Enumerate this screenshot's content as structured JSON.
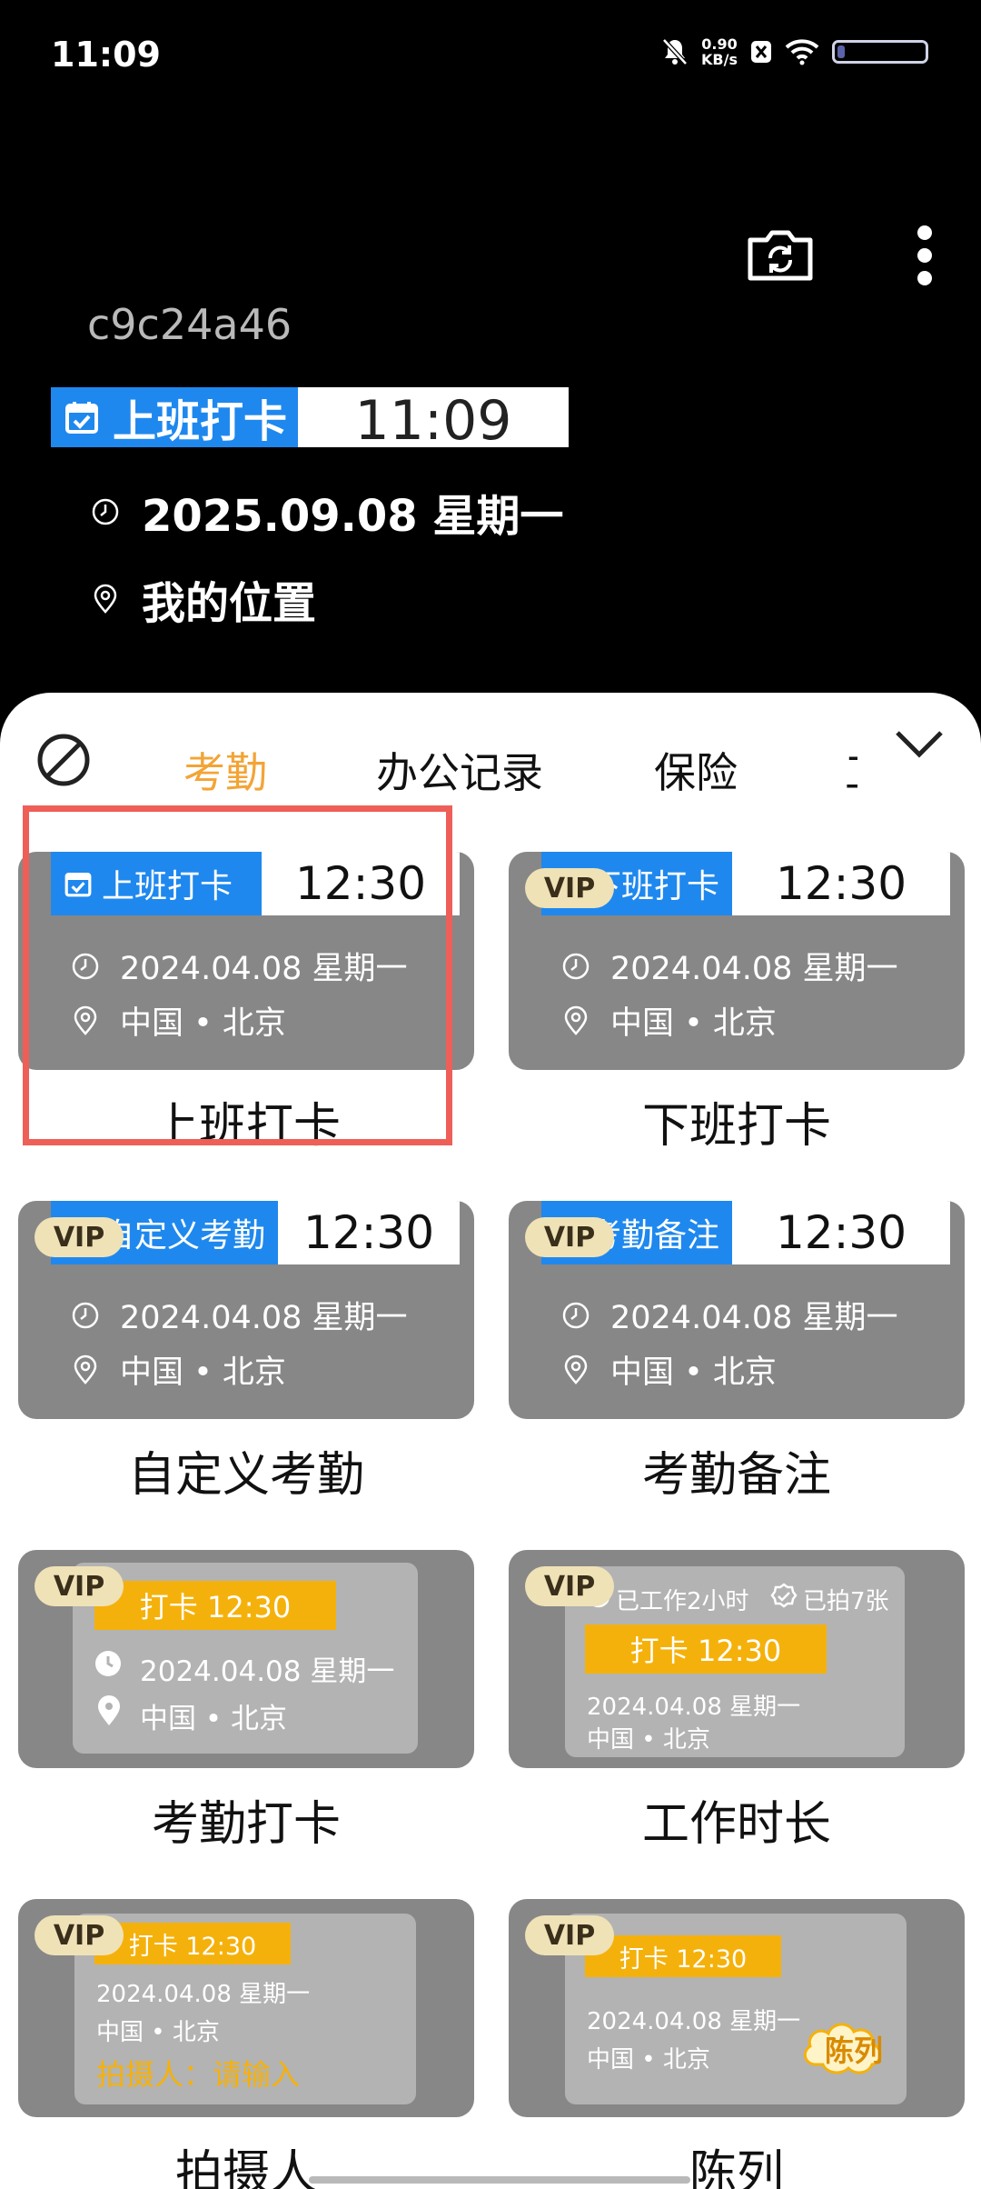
{
  "status": {
    "time": "11:09",
    "speed_value": "0.90",
    "speed_unit": "KB/s"
  },
  "camera": {
    "device_id": "c9c24a46",
    "watermark": {
      "tag": "上班打卡",
      "time": "11:09",
      "date": "2025.09.08 星期一",
      "location": "我的位置"
    }
  },
  "tabs": [
    "考勤",
    "办公记录",
    "保险",
    "工"
  ],
  "templates": {
    "card1": {
      "tag": "上班打卡",
      "time": "12:30",
      "date": "2024.04.08  星期一",
      "location": "中国 • 北京",
      "caption": "上班打卡"
    },
    "card2": {
      "vip": "VIP",
      "tag": "下班打卡",
      "time": "12:30",
      "date": "2024.04.08  星期一",
      "location": "中国 • 北京",
      "caption": "下班打卡"
    },
    "card3": {
      "vip": "VIP",
      "tag": "自定义考勤",
      "time": "12:30",
      "date": "2024.04.08  星期一",
      "location": "中国 • 北京",
      "caption": "自定义考勤"
    },
    "card4": {
      "vip": "VIP",
      "tag": "考勤备注",
      "time": "12:30",
      "date": "2024.04.08  星期一",
      "location": "中国 • 北京",
      "caption": "考勤备注"
    },
    "card5": {
      "vip": "VIP",
      "bar": "打卡  12:30",
      "date": "2024.04.08  星期一",
      "location": "中国 • 北京",
      "caption": "考勤打卡"
    },
    "card6": {
      "vip": "VIP",
      "worked": "已工作2小时",
      "photos": "已拍7张",
      "bar": "打卡  12:30",
      "date": "2024.04.08 星期一",
      "location": "中国 • 北京",
      "caption": "工作时长"
    },
    "card7": {
      "vip": "VIP",
      "bar": "打卡  12:30",
      "date": "2024.04.08  星期一",
      "location": "中国 • 北京",
      "photographer": "拍摄人：请输入",
      "caption": "拍摄人"
    },
    "card8": {
      "vip": "VIP",
      "bar": "打卡  12:30",
      "date": "2024.04.08 星期一",
      "location": "中国 • 北京",
      "badge": "陈列",
      "caption": "陈列"
    }
  }
}
